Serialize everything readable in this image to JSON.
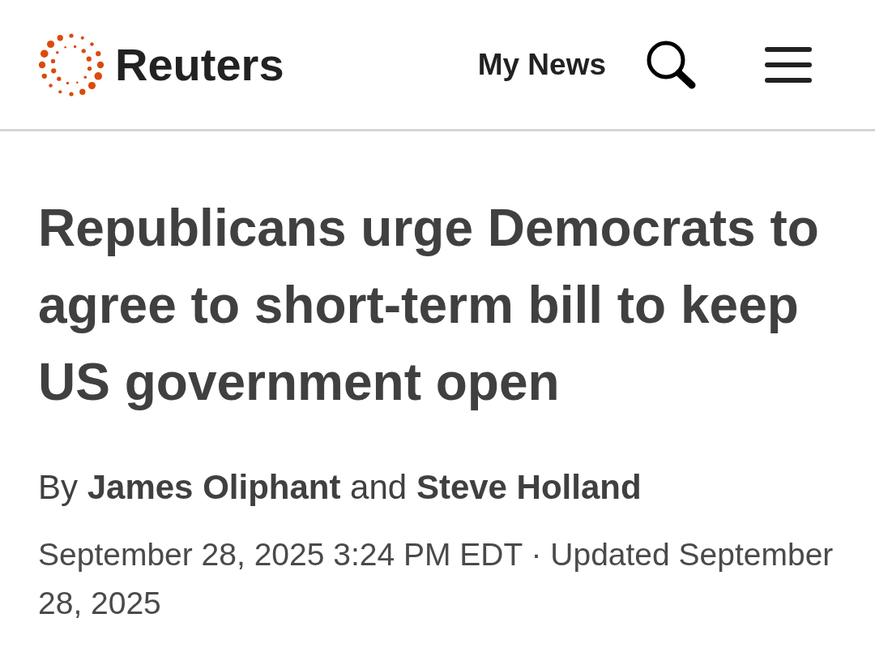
{
  "header": {
    "brand": "Reuters",
    "nav_link": "My News"
  },
  "article": {
    "headline": "Republicans urge Democrats to agree to short-term bill to keep US government open",
    "byline": "By **James Oliphant** and **Steve Holland**",
    "dateline": "September 28, 2025 3:24 PM EDT · Updated September 28, 2025"
  }
}
